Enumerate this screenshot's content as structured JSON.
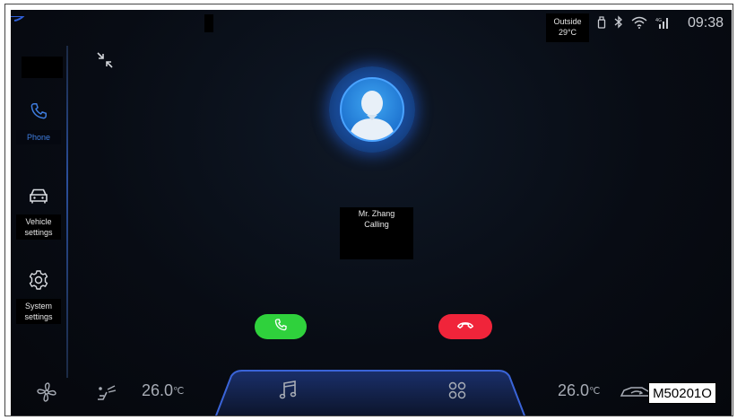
{
  "status_bar": {
    "outside_label": "Outside",
    "outside_temp": "29°C",
    "time": "09:38",
    "icons": [
      "usb-icon",
      "bluetooth-icon",
      "wifi-icon",
      "signal-icon"
    ]
  },
  "sidebar": {
    "items": [
      {
        "label": "Phone",
        "icon": "phone-icon",
        "active": true
      },
      {
        "label": "Vehicle settings",
        "icon": "car-icon"
      },
      {
        "label": "System settings",
        "icon": "gear-icon"
      }
    ]
  },
  "call": {
    "caller_name": "Mr. Zhang",
    "status": "Calling",
    "answer_color": "#2fd13c",
    "decline_color": "#f0243a"
  },
  "bottom_bar": {
    "left_temp": "26.0",
    "right_temp": "26.0",
    "temp_unit": "℃",
    "icons": [
      "fan-icon",
      "seat-airflow-icon",
      "music-icon",
      "apps-icon",
      "car-recirculation-icon",
      "rear-defrost-icon"
    ]
  },
  "watermark": "M50201O",
  "colors": {
    "accent": "#3f7ee0",
    "background": "#080c14"
  }
}
